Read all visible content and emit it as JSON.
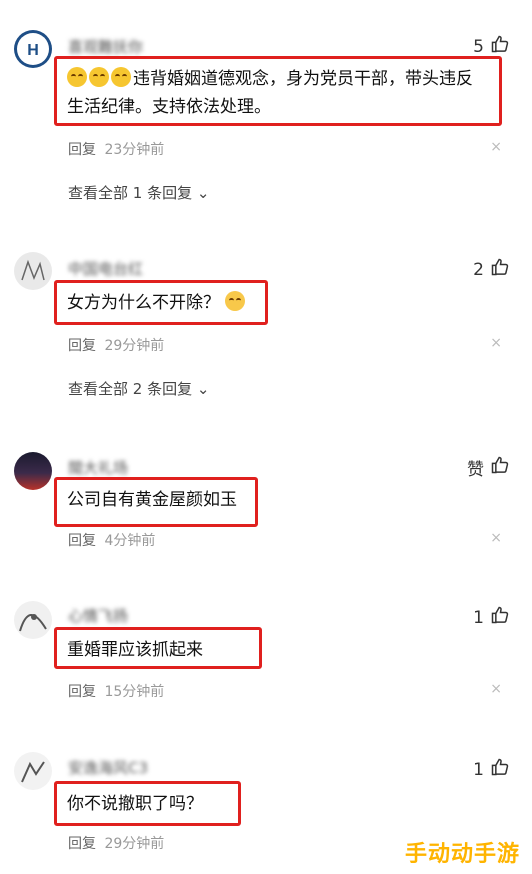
{
  "comments": [
    {
      "username": "喜观難抚你",
      "likes": "5",
      "text_line1": "违背婚姻道德观念，身为党员干部，带头违反",
      "text_line2": "生活纪律。支持依法处理。",
      "reply_label": "回复",
      "time": "23分钟前",
      "view_all": "查看全部 1 条回复"
    },
    {
      "username": "中国电台红",
      "likes": "2",
      "text": "女方为什么不开除？",
      "reply_label": "回复",
      "time": "29分钟前",
      "view_all": "查看全部 2 条回复"
    },
    {
      "username": "閩大礼场",
      "likes": "赞",
      "text": "公司自有黄金屋颜如玉",
      "reply_label": "回复",
      "time": "4分钟前"
    },
    {
      "username": "心情飞扬",
      "likes": "1",
      "text": "重婚罪应该抓起来",
      "reply_label": "回复",
      "time": "15分钟前"
    },
    {
      "username": "安逸海风C3",
      "likes": "1",
      "text": "你不说撤职了吗？",
      "reply_label": "回复",
      "time": "29分钟前"
    }
  ],
  "close_symbol": "×",
  "chevron": "⌄",
  "watermark": "手动动手游"
}
